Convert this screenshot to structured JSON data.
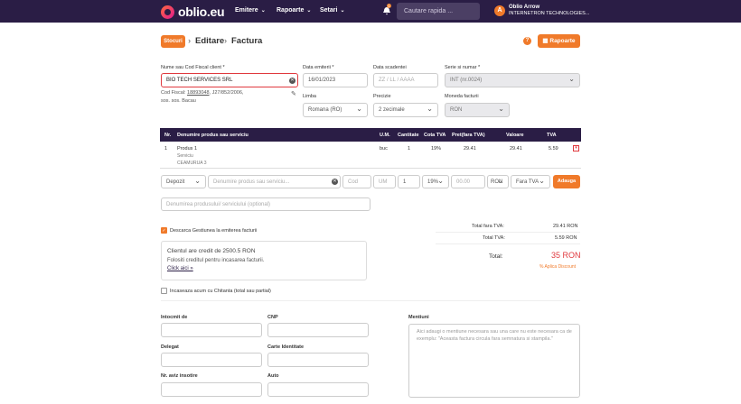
{
  "nav": {
    "logo": "oblio.eu",
    "menu": [
      "Emitere",
      "Rapoarte",
      "Setari"
    ],
    "badge": "1",
    "search_placeholder": "Cautare rapida ...",
    "avatar_initial": "A",
    "user_name": "Oblio Arrow",
    "user_company": "INTERNETRON TECHNOLOGIES..."
  },
  "breadcrumb": {
    "stocuri": "Stocuri",
    "sep": "›",
    "editare": "Editare",
    "factura": "Factura"
  },
  "help": "?",
  "rapoarte_btn": "Rapoarte",
  "client": {
    "label": "Nume sau Cod Fiscal client *",
    "value": "BIO TECH SERVICES SRL",
    "info_line1_prefix": "Cod Fiscal: ",
    "cod_fiscal": "18893048",
    "info_line1_suffix": ", J27/852/2006,",
    "info_line2": "sos. sos. Bacau"
  },
  "fields": {
    "data_emiterii_label": "Data emiterii *",
    "data_emiterii": "16/01/2023",
    "data_scadentei_label": "Data scadentei",
    "data_scadentei_ph": "ZZ / LL / AAAA",
    "serie_label": "Serie si numar *",
    "serie": "INT (nr.0024)",
    "limba_label": "Limba",
    "limba": "Romana (RO)",
    "precizie_label": "Precizie",
    "precizie": "2 zecimale",
    "moneda_label": "Moneda facturii",
    "moneda": "RON"
  },
  "table": {
    "headers": [
      "Nr.",
      "Denumire produs sau serviciu",
      "U.M.",
      "Cantitate",
      "Cota TVA",
      "Pret(fara TVA)",
      "Valoare",
      "TVA"
    ],
    "row": {
      "nr": "1",
      "name": "Produs 1",
      "type": "Serviciu",
      "code": "CEAMURUA 3",
      "um": "buc",
      "qty": "1",
      "cota": "19%",
      "pret": "29.41",
      "valoare": "29.41",
      "tva": "5.59"
    }
  },
  "add": {
    "gestiune": "Depozit",
    "produs_ph": "Denumire produs sau serviciu...",
    "cod_ph": "Cod",
    "um_ph": "UM",
    "qty": "1",
    "cota": "19%",
    "pret_ph": "00.00",
    "moneda": "RON",
    "tva_mode": "Fara TVA",
    "add_btn": "Adauga",
    "desc_ph": "Denumirea produsului/ serviciului (optional)"
  },
  "gestiune_label": "Descarca Gestiunea la emiterea facturii",
  "credit": {
    "line1": "Clientul are credit de 2500.5 RON",
    "line2": "Folositi creditul pentru incasarea facturii.",
    "link": "Click aici »"
  },
  "incasare_label": "Incaseaza acum cu Chitanta (total sau partial)",
  "totals": {
    "fara_tva_label": "Total fara TVA:",
    "fara_tva": "29.41 RON",
    "tva_label": "Total TVA:",
    "tva": "5.59 RON",
    "total_label": "Total:",
    "total": "35 RON",
    "discount": "% Aplica Discount"
  },
  "delegate": {
    "intocmit": "Intocmit de",
    "cnp": "CNP",
    "delegat": "Delegat",
    "carte": "Carte Identitate",
    "aviz": "Nr. aviz insotire",
    "auto": "Auto"
  },
  "mentiuni": {
    "label": "Mentiuni",
    "placeholder": "Aici adaugi o mentiune necesara sau una care nu este necesara ca de exemplu: \"Aceasta factura circula fara semnatura si stampila.\""
  },
  "colors": {
    "nav": "#2a1d45",
    "accent": "#f07a2a",
    "link": "#2a1d45"
  }
}
